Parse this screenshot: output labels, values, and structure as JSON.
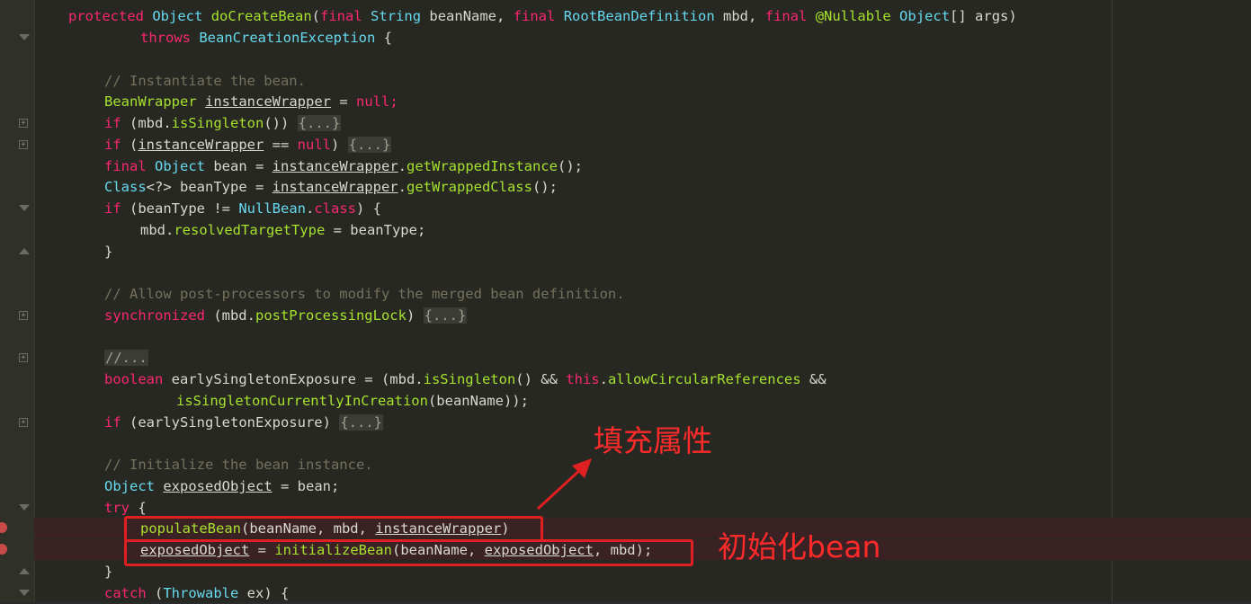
{
  "colors": {
    "background": "#272822",
    "keyword": "#f92672",
    "type": "#66d9ef",
    "function": "#a6e22e",
    "comment": "#75715e",
    "annotation_red": "#e02020"
  },
  "gutter_icons": [
    "breakpoint-icon",
    "fold-icon"
  ],
  "code": {
    "l1": {
      "protected": "protected",
      "object": "Object",
      "fn": "doCreateBean",
      "p1": "(",
      "final1": "final",
      "string": "String",
      "p2": " beanName, ",
      "final2": "final",
      "rbd": "RootBeanDefinition",
      "p3": " mbd, ",
      "final3": "final",
      "nullable": "@Nullable",
      "object2": "Object",
      "p4": "[] args)"
    },
    "l2": {
      "throws": "throws",
      "exc": "BeanCreationException",
      "p": " {"
    },
    "l3": {
      "comment": "// Instantiate the bean."
    },
    "l4": {
      "type": "BeanWrapper",
      "var": "instanceWrapper",
      "p": " = ",
      "null": "null",
      "end": ";"
    },
    "l5": {
      "if": "if",
      "p1": " (mbd.",
      "fn": "isSingleton",
      "p2": "()) ",
      "fold": "{...}"
    },
    "l6": {
      "if": "if",
      "p1": " (",
      "var": "instanceWrapper",
      "p2": " == ",
      "null": "null",
      "p3": ") ",
      "fold": "{...}"
    },
    "l7": {
      "final": "final",
      "object": "Object",
      "p1": " bean = ",
      "var": "instanceWrapper",
      "p2": ".",
      "fn": "getWrappedInstance",
      "p3": "();"
    },
    "l8": {
      "cls": "Class",
      "p1": "<?> beanType = ",
      "var": "instanceWrapper",
      "p2": ".",
      "fn": "getWrappedClass",
      "p3": "();"
    },
    "l9": {
      "if": "if",
      "p1": " (beanType != ",
      "nb": "NullBean",
      "p2": ".",
      "cls": "class",
      "p3": ") {"
    },
    "l10": {
      "p1": "mbd.",
      "fn": "resolvedTargetType",
      "p2": " = beanType;"
    },
    "l11": {
      "p": "}"
    },
    "l12": {
      "comment": "// Allow post-processors to modify the merged bean definition."
    },
    "l13": {
      "sync": "synchronized",
      "p1": " (mbd.",
      "fn": "postProcessingLock",
      "p2": ") ",
      "fold": "{...}"
    },
    "l14": {
      "fold": "//..."
    },
    "l15": {
      "bool": "boolean",
      "p1": " earlySingletonExposure = (mbd.",
      "fn1": "isSingleton",
      "p2": "() && ",
      "this": "this",
      "p3": ".",
      "fn2": "allowCircularReferences",
      "p4": " &&"
    },
    "l16": {
      "fn": "isSingletonCurrentlyInCreation",
      "p": "(beanName));"
    },
    "l17": {
      "if": "if",
      "p1": " (earlySingletonExposure) ",
      "fold": "{...}"
    },
    "l18": {
      "comment": "// Initialize the bean instance."
    },
    "l19": {
      "object": "Object",
      "p1": " ",
      "var": "exposedObject",
      "p2": " = bean;"
    },
    "l20": {
      "try": "try",
      "p": " {"
    },
    "l21": {
      "fn": "populateBean",
      "p1": "(beanName, mbd, ",
      "var": "instanceWrapper",
      "p2": ")"
    },
    "l22": {
      "var1": "exposedObject",
      "p1": " = ",
      "fn": "initializeBean",
      "p2": "(beanName, ",
      "var2": "exposedObject",
      "p3": ", mbd);"
    },
    "l23": {
      "p": "}"
    },
    "l24": {
      "catch": "catch",
      "p1": " (",
      "thr": "Throwable",
      "p2": " ex) {"
    }
  },
  "annotations": {
    "populate_label": "填充属性",
    "initialize_label": "初始化bean"
  }
}
